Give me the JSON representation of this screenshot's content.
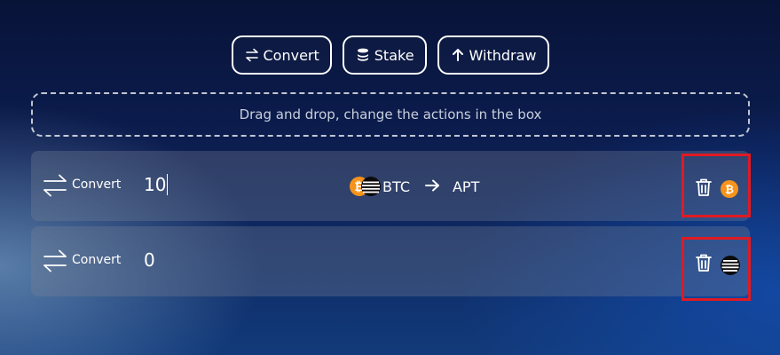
{
  "toolbar": {
    "convert_label": "Convert",
    "stake_label": "Stake",
    "withdraw_label": "Withdraw"
  },
  "dropzone": {
    "text": "Drag and drop, change the actions in the box"
  },
  "rows": [
    {
      "action": "Convert",
      "amount": "10",
      "from_token": "BTC",
      "to_token": "APT",
      "selected_token_icon": "bitcoin-icon"
    },
    {
      "action": "Convert",
      "amount": "0",
      "selected_token_icon": "aptos-icon"
    }
  ],
  "colors": {
    "bitcoin": "#f7931a",
    "aptos": "#0b0b0b",
    "highlight": "#e01a22",
    "row_bg": "rgba(120,130,150,0.33)"
  }
}
